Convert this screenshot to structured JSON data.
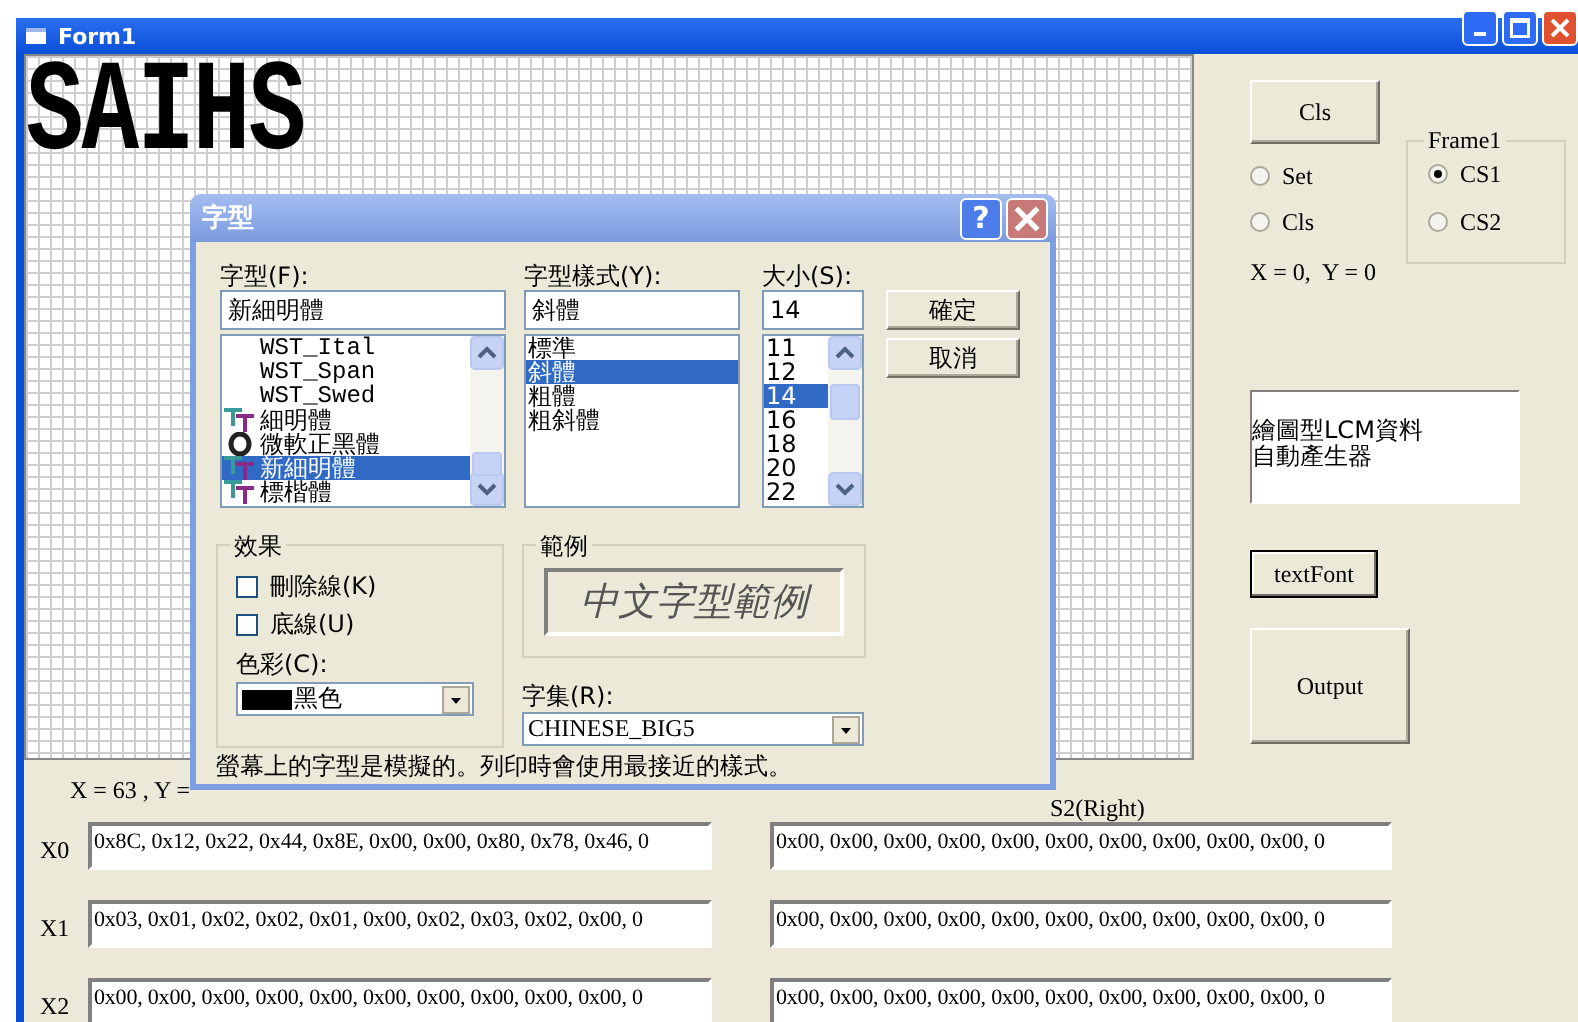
{
  "window": {
    "title": "Form1"
  },
  "lcm_grid": {
    "text": "SAIHS"
  },
  "side_panel": {
    "cls_button": "Cls",
    "radios": [
      {
        "label": "Set",
        "selected": false
      },
      {
        "label": "Cls",
        "selected": false
      }
    ],
    "frame": {
      "title": "Frame1",
      "radios": [
        {
          "label": "CS1",
          "selected": true
        },
        {
          "label": "CS2",
          "selected": false
        }
      ]
    },
    "coords": "X = 0,  Y = 0",
    "textbox": [
      "繪圖型LCM資料",
      "自動產生器"
    ],
    "font_button": "textFont",
    "output_button": "Output"
  },
  "bottom": {
    "coords": "X = 63 , Y =",
    "column_label": "S2(Right)",
    "rows": [
      {
        "label": "X0",
        "left": "0x8C, 0x12, 0x22, 0x44, 0x8E, 0x00, 0x00, 0x80, 0x78, 0x46, 0",
        "right": "0x00, 0x00, 0x00, 0x00, 0x00, 0x00, 0x00, 0x00, 0x00, 0x00, 0"
      },
      {
        "label": "X1",
        "left": "0x03, 0x01, 0x02, 0x02, 0x01, 0x00, 0x02, 0x03, 0x02, 0x00, 0",
        "right": "0x00, 0x00, 0x00, 0x00, 0x00, 0x00, 0x00, 0x00, 0x00, 0x00, 0"
      },
      {
        "label": "X2",
        "left": "0x00, 0x00, 0x00, 0x00, 0x00, 0x00, 0x00, 0x00, 0x00, 0x00, 0",
        "right": "0x00, 0x00, 0x00, 0x00, 0x00, 0x00, 0x00, 0x00, 0x00, 0x00, 0"
      }
    ]
  },
  "font_dialog": {
    "title": "字型",
    "help_button": "?",
    "font": {
      "label": "字型(F):",
      "value": "新細明體",
      "items": [
        {
          "text": "WST_Ital",
          "kind": "plain",
          "selected": false
        },
        {
          "text": "WST_Span",
          "kind": "plain",
          "selected": false
        },
        {
          "text": "WST_Swed",
          "kind": "plain",
          "selected": false
        },
        {
          "text": "細明體",
          "kind": "truetype",
          "selected": false
        },
        {
          "text": "微軟正黑體",
          "kind": "opentype",
          "selected": false
        },
        {
          "text": "新細明體",
          "kind": "truetype",
          "selected": true
        },
        {
          "text": "標楷體",
          "kind": "truetype",
          "selected": false
        }
      ]
    },
    "style": {
      "label": "字型樣式(Y):",
      "value": "斜體",
      "items": [
        {
          "text": "標準",
          "selected": false
        },
        {
          "text": "斜體",
          "selected": true
        },
        {
          "text": "粗體",
          "selected": false
        },
        {
          "text": "粗斜體",
          "selected": false
        }
      ]
    },
    "size": {
      "label": "大小(S):",
      "value": "14",
      "items": [
        {
          "text": "11",
          "selected": false
        },
        {
          "text": "12",
          "selected": false
        },
        {
          "text": "14",
          "selected": true
        },
        {
          "text": "16",
          "selected": false
        },
        {
          "text": "18",
          "selected": false
        },
        {
          "text": "20",
          "selected": false
        },
        {
          "text": "22",
          "selected": false
        }
      ]
    },
    "ok_button": "確定",
    "cancel_button": "取消",
    "effects": {
      "title": "效果",
      "checkboxes": [
        {
          "label": "刪除線(K)",
          "checked": false
        },
        {
          "label": "底線(U)",
          "checked": false
        }
      ],
      "color_label": "色彩(C):",
      "color_value": "黑色"
    },
    "sample": {
      "title": "範例",
      "text": "中文字型範例"
    },
    "script": {
      "label": "字集(R):",
      "value": "CHINESE_BIG5"
    },
    "note": "螢幕上的字型是模擬的。列印時會使用最接近的樣式。"
  }
}
